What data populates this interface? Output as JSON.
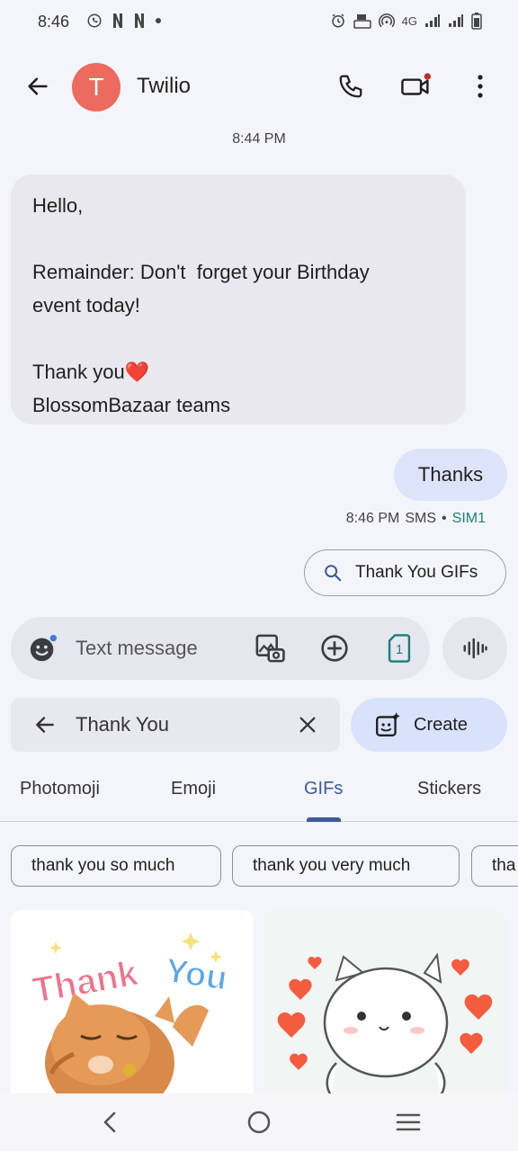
{
  "status_bar": {
    "time": "8:46",
    "network": "4G"
  },
  "header": {
    "avatar_letter": "T",
    "contact_name": "Twilio"
  },
  "conversation": {
    "timestamp": "8:44 PM",
    "incoming_lines": [
      "Hello,",
      "",
      "Remainder: Don't  forget your Birthday",
      "event today!",
      "",
      "Thank you❤️",
      "BlossomBazaar teams"
    ],
    "outgoing_text": "Thanks",
    "outgoing_time": "8:46 PM",
    "outgoing_type": "SMS",
    "outgoing_sim": "SIM1"
  },
  "gif_suggestion": "Thank You GIFs",
  "compose": {
    "placeholder": "Text message",
    "sim_number": "1"
  },
  "gif_panel": {
    "search_query": "Thank You",
    "create_label": "Create",
    "tabs": [
      "Photomoji",
      "Emoji",
      "GIFs",
      "Stickers"
    ],
    "active_tab": "GIFs",
    "chips": [
      "thank you so much",
      "thank you very much",
      "tha"
    ],
    "gif1_text_a": "Thank",
    "gif1_text_b": "You"
  },
  "colors": {
    "avatar": "#ec6a5e",
    "accent": "#3d5a9c",
    "sim": "#1a7f7a"
  }
}
